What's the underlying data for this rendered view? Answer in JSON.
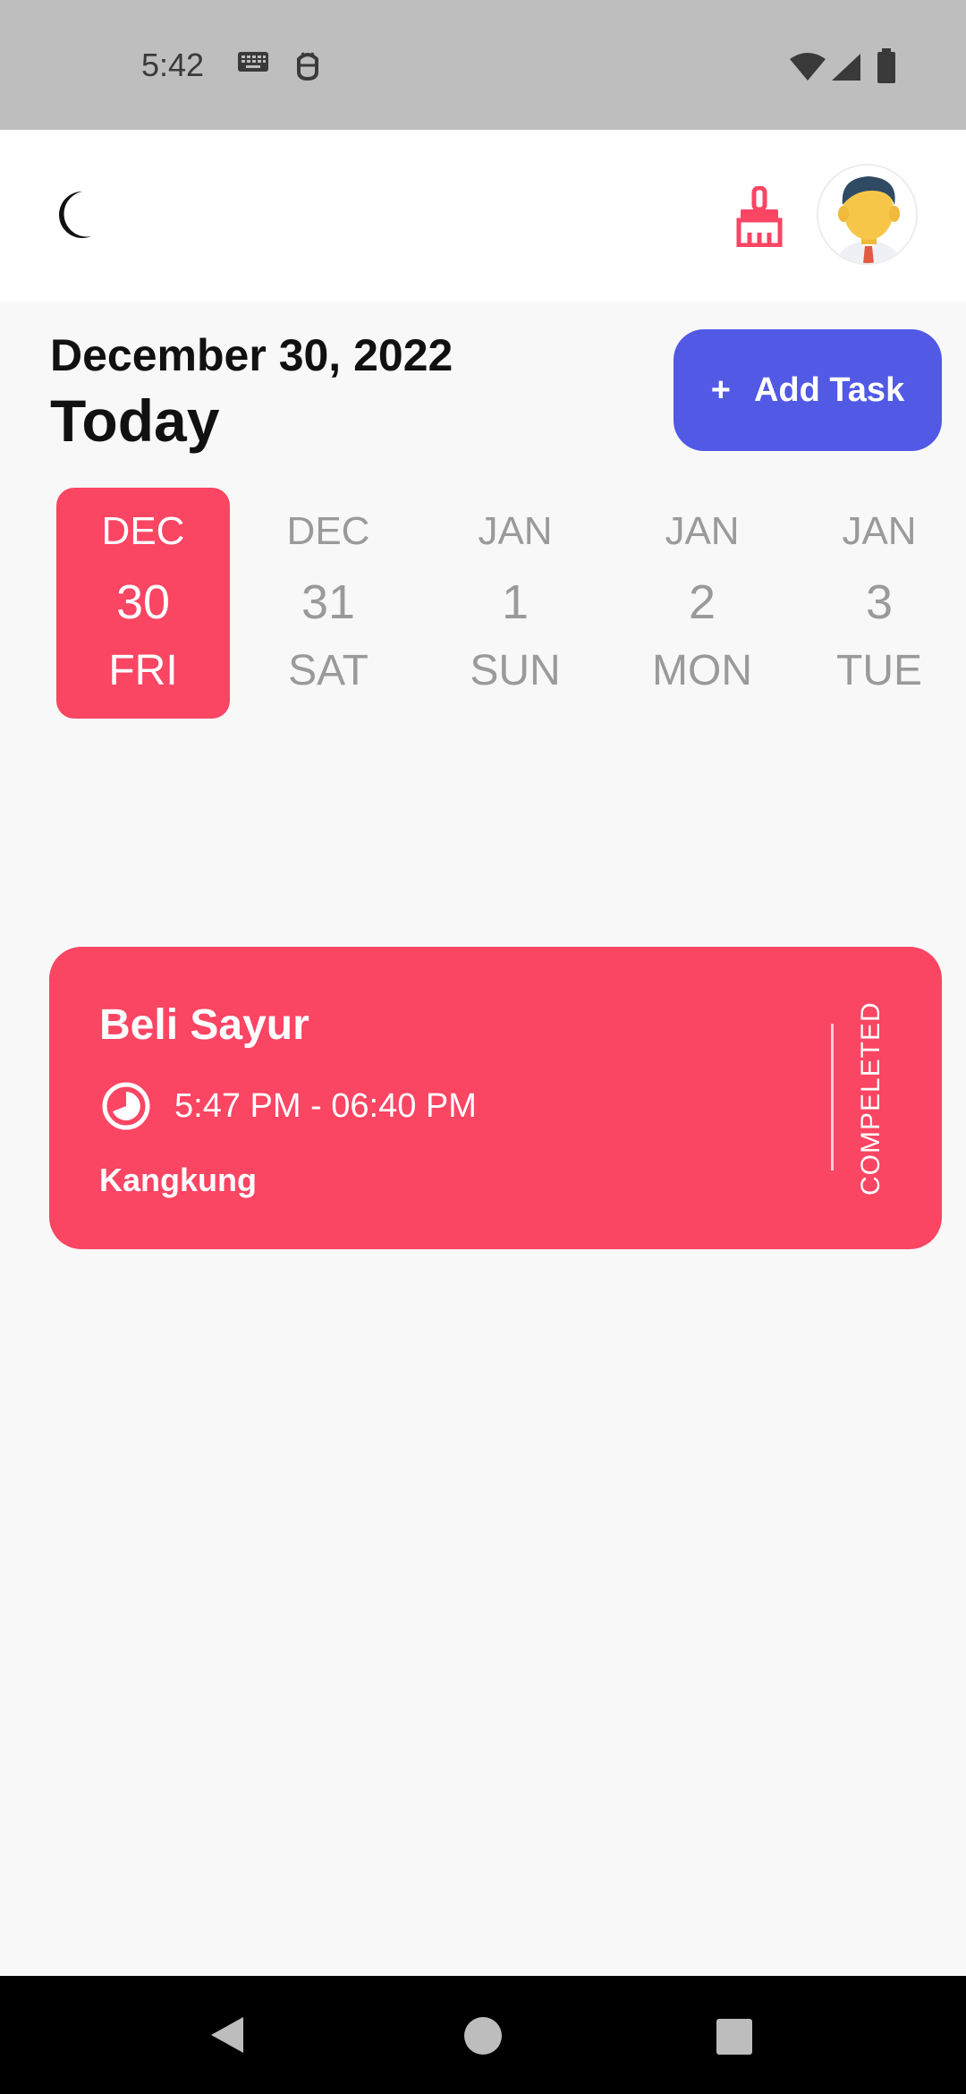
{
  "status_bar": {
    "time": "5:42",
    "icons": [
      "keyboard-icon",
      "android-debug-icon",
      "wifi-icon",
      "cell-signal-icon",
      "battery-icon"
    ]
  },
  "app_bar": {
    "theme_toggle_icon": "moon-icon",
    "clear_icon": "broom-icon",
    "avatar": "avatar"
  },
  "header": {
    "date": "December 30, 2022",
    "title": "Today",
    "add_button": {
      "plus": "+",
      "label": "Add Task"
    }
  },
  "date_picker": {
    "days": [
      {
        "month": "DEC",
        "day": "30",
        "weekday": "FRI",
        "selected": true
      },
      {
        "month": "DEC",
        "day": "31",
        "weekday": "SAT",
        "selected": false
      },
      {
        "month": "JAN",
        "day": "1",
        "weekday": "SUN",
        "selected": false
      },
      {
        "month": "JAN",
        "day": "2",
        "weekday": "MON",
        "selected": false
      },
      {
        "month": "JAN",
        "day": "3",
        "weekday": "TUE",
        "selected": false
      }
    ]
  },
  "tasks": [
    {
      "title": "Beli Sayur",
      "time": "5:47 PM - 06:40 PM",
      "note": "Kangkung",
      "status": "COMPELETED",
      "color": "#fa4563"
    }
  ],
  "colors": {
    "accent": "#fa4563",
    "primary": "#5159e5",
    "status_bar_bg": "#bebebe"
  },
  "nav_bar": {
    "icons": [
      "back-icon",
      "home-icon",
      "recents-icon"
    ]
  }
}
